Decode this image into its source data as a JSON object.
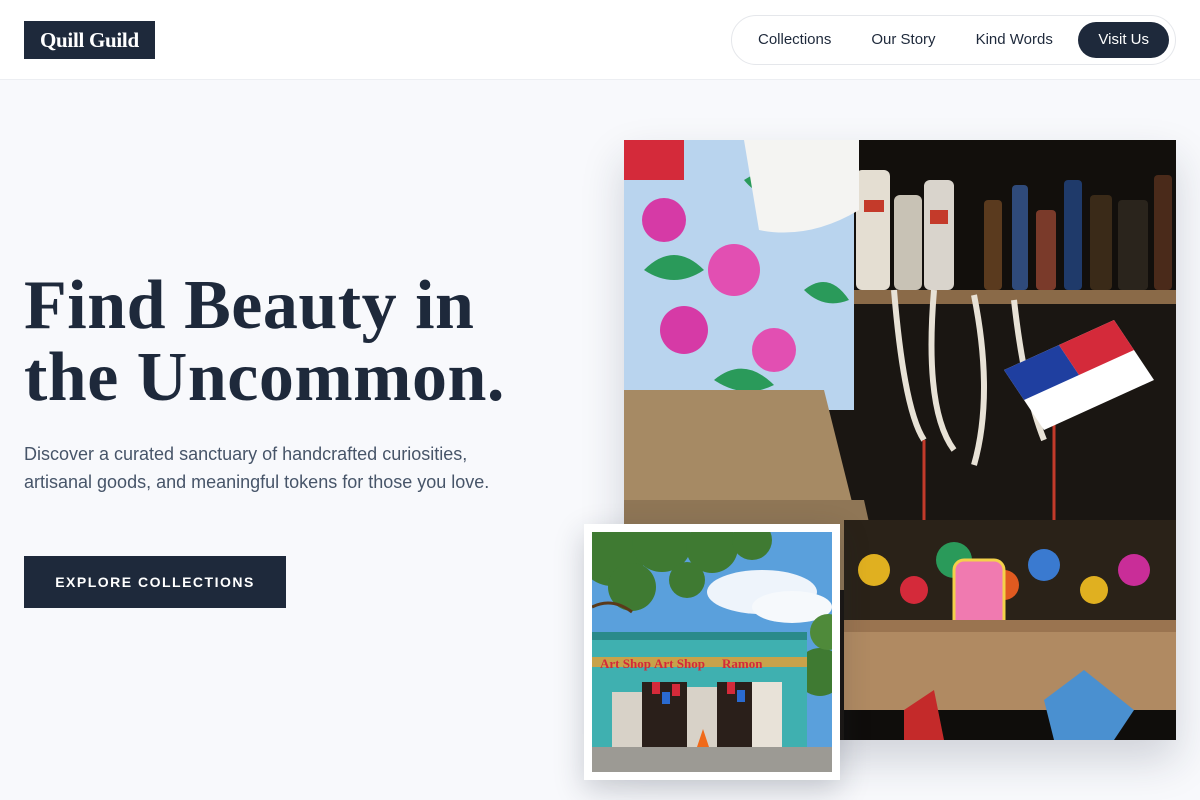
{
  "brand": {
    "name": "Quill Guild"
  },
  "nav": {
    "items": [
      {
        "label": "Collections"
      },
      {
        "label": "Our Story"
      },
      {
        "label": "Kind Words"
      }
    ],
    "cta_label": "Visit Us"
  },
  "hero": {
    "title_line1": "Find Beauty in",
    "title_line2": "the Uncommon.",
    "subtitle": "Discover a curated sanctuary of handcrafted curiosities, artisanal goods, and meaningful tokens for those you love.",
    "button_label": "EXPLORE COLLECTIONS"
  },
  "images": {
    "main": {
      "name": "market-stall-photo"
    },
    "thumb": {
      "name": "art-shop-storefront-photo"
    }
  },
  "colors": {
    "navy": "#1e293b",
    "background": "#f8f9fc",
    "body_text": "#475569"
  }
}
